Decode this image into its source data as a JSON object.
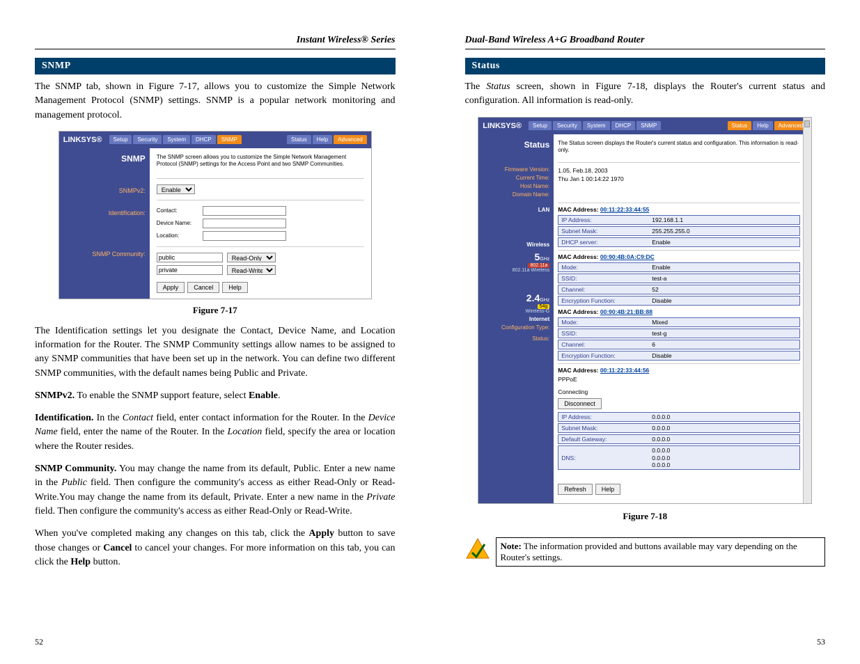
{
  "left": {
    "header": "Instant Wireless® Series",
    "section": "SNMP",
    "intro": "The SNMP tab, shown in Figure 7-17, allows you to customize the Simple Network Management Protocol (SNMP) settings. SNMP is a popular network monitoring and management protocol.",
    "figcap": "Figure 7-17",
    "p2": "The Identification settings let you designate the Contact, Device Name, and Location information for the Router. The SNMP Community settings allow names to be assigned to any SNMP communities that have been set up in the network. You can define two different SNMP communities, with the default names being Public and Private.",
    "p3_b": "SNMPv2.",
    "p3_t": " To enable the SNMP support feature, select ",
    "p3_b2": "Enable",
    "p3_t2": ".",
    "p4_b": "Identification.",
    "p4_t": " In the Contact field, enter contact information for the Router. In the Device Name field, enter the name of the Router. In the Location field, specify the area or location where the Router resides.",
    "p5_b": "SNMP Community.",
    "p5_t": " You may change the name from its default, Public. Enter a new name in the Public field. Then configure the community's access as either Read-Only or Read-Write.You may change the name from its default, Private. Enter a new name in the Private field. Then configure the community's access as either Read-Only or Read-Write.",
    "p6_a": "When you've completed making any changes on this tab, click the ",
    "p6_b1": "Apply",
    "p6_b": " button to save those changes or ",
    "p6_b2": "Cancel",
    "p6_c": " to cancel your changes. For more information on this tab, you can click the ",
    "p6_b3": "Help",
    "p6_d": " button.",
    "pagenum": "52",
    "ui": {
      "logo": "LINKSYS®",
      "tabs": [
        "Setup",
        "Security",
        "System",
        "DHCP",
        "SNMP"
      ],
      "tabs_right": [
        "Status",
        "Help",
        "Advanced"
      ],
      "title": "SNMP",
      "desc": "The SNMP screen allows you to customize the Simple Network Management Protocol (SNMP) settings for the Access Point and two SNMP Communities.",
      "side": {
        "snmpv2": "SNMPv2:",
        "ident": "Identification:",
        "comm": "SNMP Community:"
      },
      "enable_sel": "Enable",
      "id_labels": {
        "contact": "Contact:",
        "devname": "Device Name:",
        "location": "Location:"
      },
      "comm1": "public",
      "perm1": "Read-Only",
      "comm2": "private",
      "perm2": "Read-Write",
      "btn_apply": "Apply",
      "btn_cancel": "Cancel",
      "btn_help": "Help"
    }
  },
  "right": {
    "header": "Dual-Band Wireless A+G Broadband Router",
    "section": "Status",
    "intro": "The Status screen, shown in Figure 7-18, displays the Router's current status and configuration. All information is read-only.",
    "figcap": "Figure 7-18",
    "note_b": "Note:",
    "note_t": " The information provided and buttons available may vary depending on the Router's settings.",
    "pagenum": "53",
    "ui": {
      "logo": "LINKSYS®",
      "tabs": [
        "Setup",
        "Security",
        "System",
        "DHCP",
        "SNMP"
      ],
      "tabs_right": [
        "Status",
        "Help",
        "Advanced"
      ],
      "title": "Status",
      "desc": "The Status screen displays the Router's current status and configuration. This information is read-only.",
      "side": {
        "fw": "Firmware Version:",
        "ct": "Current Time:",
        "hn": "Host Name:",
        "dn": "Domain Name:",
        "lan": "LAN",
        "wl": "Wireless",
        "a": "802.11a Wireless",
        "g": "Wireless-G",
        "inet": "Internet",
        "cfg": "Configuration Type:",
        "stat": "Status:",
        "ghz5": "5",
        "ghz5u": "GHz",
        "ghz5t": "802.11a",
        "ghz24": "2.4",
        "ghz24u": "GHz",
        "ghz24t": "54g"
      },
      "fw": "1.05, Feb.18, 2003",
      "ct": "Thu Jan 1 00:14:22 1970",
      "lan_mac_l": "MAC Address: ",
      "lan_mac": "00:11:22:33:44:55",
      "lan_ip_k": "IP Address:",
      "lan_ip_v": "192.168.1.1",
      "lan_sm_k": "Subnet Mask:",
      "lan_sm_v": "255.255.255.0",
      "lan_dh_k": "DHCP server:",
      "lan_dh_v": "Enable",
      "w5_mac_l": "MAC Address: ",
      "w5_mac": "00:90:4B:0A:C9:DC",
      "w5_mode_k": "Mode:",
      "w5_mode_v": "Enable",
      "w5_ssid_k": "SSID:",
      "w5_ssid_v": "test-a",
      "w5_ch_k": "Channel:",
      "w5_ch_v": "52",
      "w5_enc_k": "Encryption Function:",
      "w5_enc_v": "Disable",
      "w24_mac_l": "MAC Address: ",
      "w24_mac": "00:90:4B:21:BB:88",
      "w24_mode_k": "Mode:",
      "w24_mode_v": "Mixed",
      "w24_ssid_k": "SSID:",
      "w24_ssid_v": "test-g",
      "w24_ch_k": "Channel:",
      "w24_ch_v": "6",
      "w24_enc_k": "Encryption Function:",
      "w24_enc_v": "Disable",
      "inet_mac_l": "MAC Address: ",
      "inet_mac": "00:11:22:33:44:56",
      "cfg_v": "PPPoE",
      "stat_v": "Connecting",
      "btn_disc": "Disconnect",
      "inet_ip_k": "IP Address:",
      "inet_ip_v": "0.0.0.0",
      "inet_sm_k": "Subnet Mask:",
      "inet_sm_v": "0.0.0.0",
      "inet_gw_k": "Default Gateway:",
      "inet_gw_v": "0.0.0.0",
      "dns_k": "DNS:",
      "dns_v1": "0.0.0.0",
      "dns_v2": "0.0.0.0",
      "dns_v3": "0.0.0.0",
      "btn_refresh": "Refresh",
      "btn_help": "Help"
    }
  }
}
